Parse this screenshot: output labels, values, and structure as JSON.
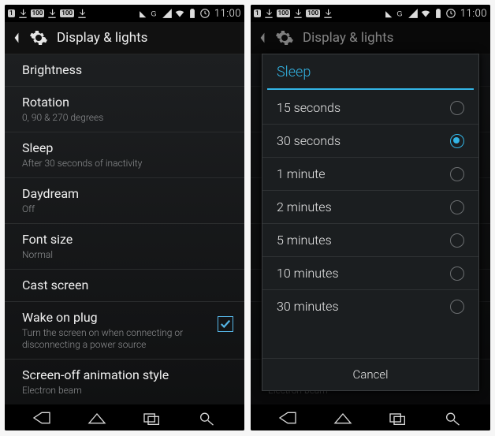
{
  "status": {
    "clock": "11:00",
    "badge_left1": "1",
    "badge_left2": "100",
    "badge_left3": "100"
  },
  "screen_title": "Display & lights",
  "settings": [
    {
      "title": "Brightness",
      "sub": null,
      "checkbox": false
    },
    {
      "title": "Rotation",
      "sub": "0, 90 & 270 degrees",
      "checkbox": false
    },
    {
      "title": "Sleep",
      "sub": "After 30 seconds of inactivity",
      "checkbox": false
    },
    {
      "title": "Daydream",
      "sub": "Off",
      "checkbox": false
    },
    {
      "title": "Font size",
      "sub": "Normal",
      "checkbox": false
    },
    {
      "title": "Cast screen",
      "sub": null,
      "checkbox": false
    },
    {
      "title": "Wake on plug",
      "sub": "Turn the screen on when connecting or disconnecting a power source",
      "checkbox": true,
      "checked": true
    },
    {
      "title": "Screen-off animation style",
      "sub": "Electron beam",
      "checkbox": false
    }
  ],
  "dialog": {
    "title": "Sleep",
    "options": [
      {
        "label": "15 seconds",
        "selected": false
      },
      {
        "label": "30 seconds",
        "selected": true
      },
      {
        "label": "1 minute",
        "selected": false
      },
      {
        "label": "2 minutes",
        "selected": false
      },
      {
        "label": "5 minutes",
        "selected": false
      },
      {
        "label": "10 minutes",
        "selected": false
      },
      {
        "label": "30 minutes",
        "selected": false
      }
    ],
    "cancel": "Cancel"
  }
}
